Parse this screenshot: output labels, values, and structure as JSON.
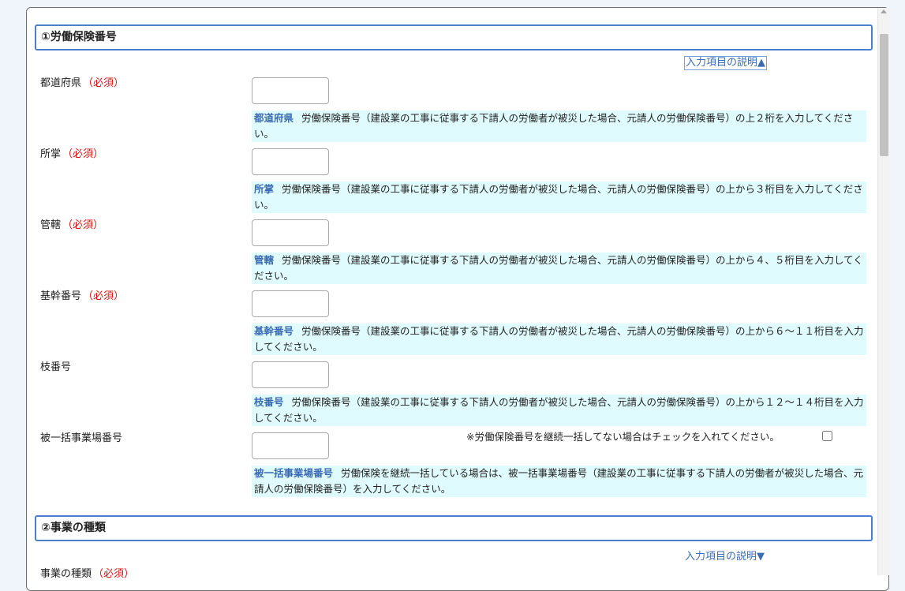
{
  "section1": {
    "title": "①労働保険番号",
    "help_toggle": "入力項目の説明▲"
  },
  "required_label": "（必須）",
  "fields": {
    "prefecture": {
      "label": "都道府県",
      "help_term": "都道府県",
      "help_text": "労働保険番号（建設業の工事に従事する下請人の労働者が被災した場合、元請人の労働保険番号）の上２桁を入力してください。"
    },
    "office": {
      "label": "所掌",
      "help_term": "所掌",
      "help_text": "労働保険番号（建設業の工事に従事する下請人の労働者が被災した場合、元請人の労働保険番号）の上から３桁目を入力してください。"
    },
    "jurisdiction": {
      "label": "管轄",
      "help_term": "管轄",
      "help_text": "労働保険番号（建設業の工事に従事する下請人の労働者が被災した場合、元請人の労働保険番号）の上から４、５桁目を入力してください。"
    },
    "base_number": {
      "label": "基幹番号",
      "help_term": "基幹番号",
      "help_text": "労働保険番号（建設業の工事に従事する下請人の労働者が被災した場合、元請人の労働保険番号）の上から６～１１桁目を入力してください。"
    },
    "branch_number": {
      "label": "枝番号",
      "help_term": "枝番号",
      "help_text": "労働保険番号（建設業の工事に従事する下請人の労働者が被災した場合、元請人の労働保険番号）の上から１２～１４桁目を入力してください。"
    },
    "sub_workplace": {
      "label": "被一括事業場番号",
      "note": "※労働保険番号を継続一括してない場合はチェックを入れてください。",
      "help_term": "被一括事業場番号",
      "help_text": "労働保険を継続一括している場合は、被一括事業場番号（建設業の工事に従事する下請人の労働者が被災した場合、元請人の労働保険番号）を入力してください。"
    }
  },
  "section2": {
    "title": "②事業の種類",
    "help_toggle": "入力項目の説明▼",
    "field_label": "事業の種類"
  },
  "colors": {
    "accent": "#4a7fd0",
    "required": "#dd1111",
    "help_bg": "#dffbfd",
    "help_term": "#3b6bb3"
  }
}
